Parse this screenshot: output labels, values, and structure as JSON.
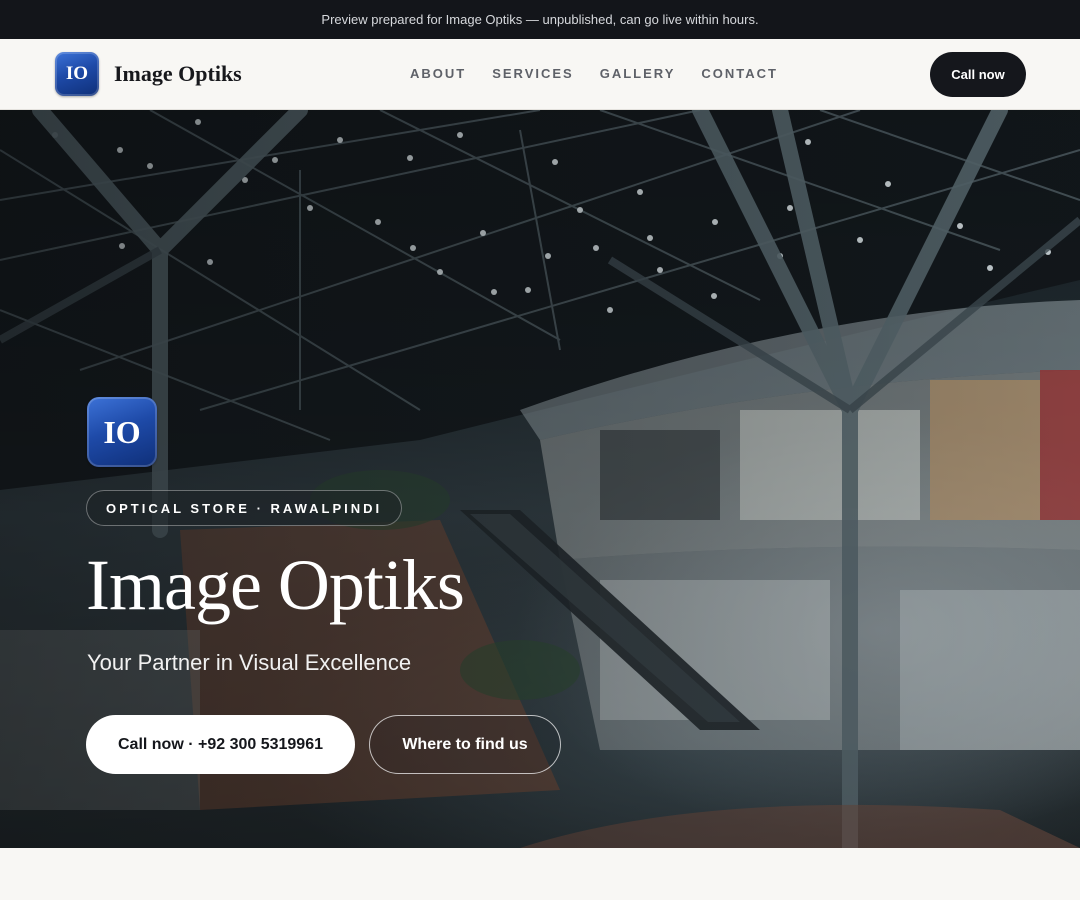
{
  "preview_banner": {
    "text": "Preview prepared for Image Optiks — unpublished, can go live within hours."
  },
  "navbar": {
    "logo_text": "IO",
    "brand_name": "Image Optiks",
    "links": [
      {
        "label": "ABOUT"
      },
      {
        "label": "SERVICES"
      },
      {
        "label": "GALLERY"
      },
      {
        "label": "CONTACT"
      }
    ],
    "cta_label": "Call now"
  },
  "hero": {
    "logo_text": "IO",
    "tag": "OPTICAL STORE · RAWALPINDI",
    "title": "Image Optiks",
    "subtitle": "Your Partner in Visual Excellence",
    "primary_button": "Call now · +92 300 5319961",
    "secondary_button": "Where to find us",
    "background_image": "shopping-mall-interior-photo"
  },
  "colors": {
    "banner_bg": "#13151a",
    "nav_bg": "#f8f7f4",
    "dark_button": "#15171c",
    "logo_blue": "#1e4aa8"
  }
}
